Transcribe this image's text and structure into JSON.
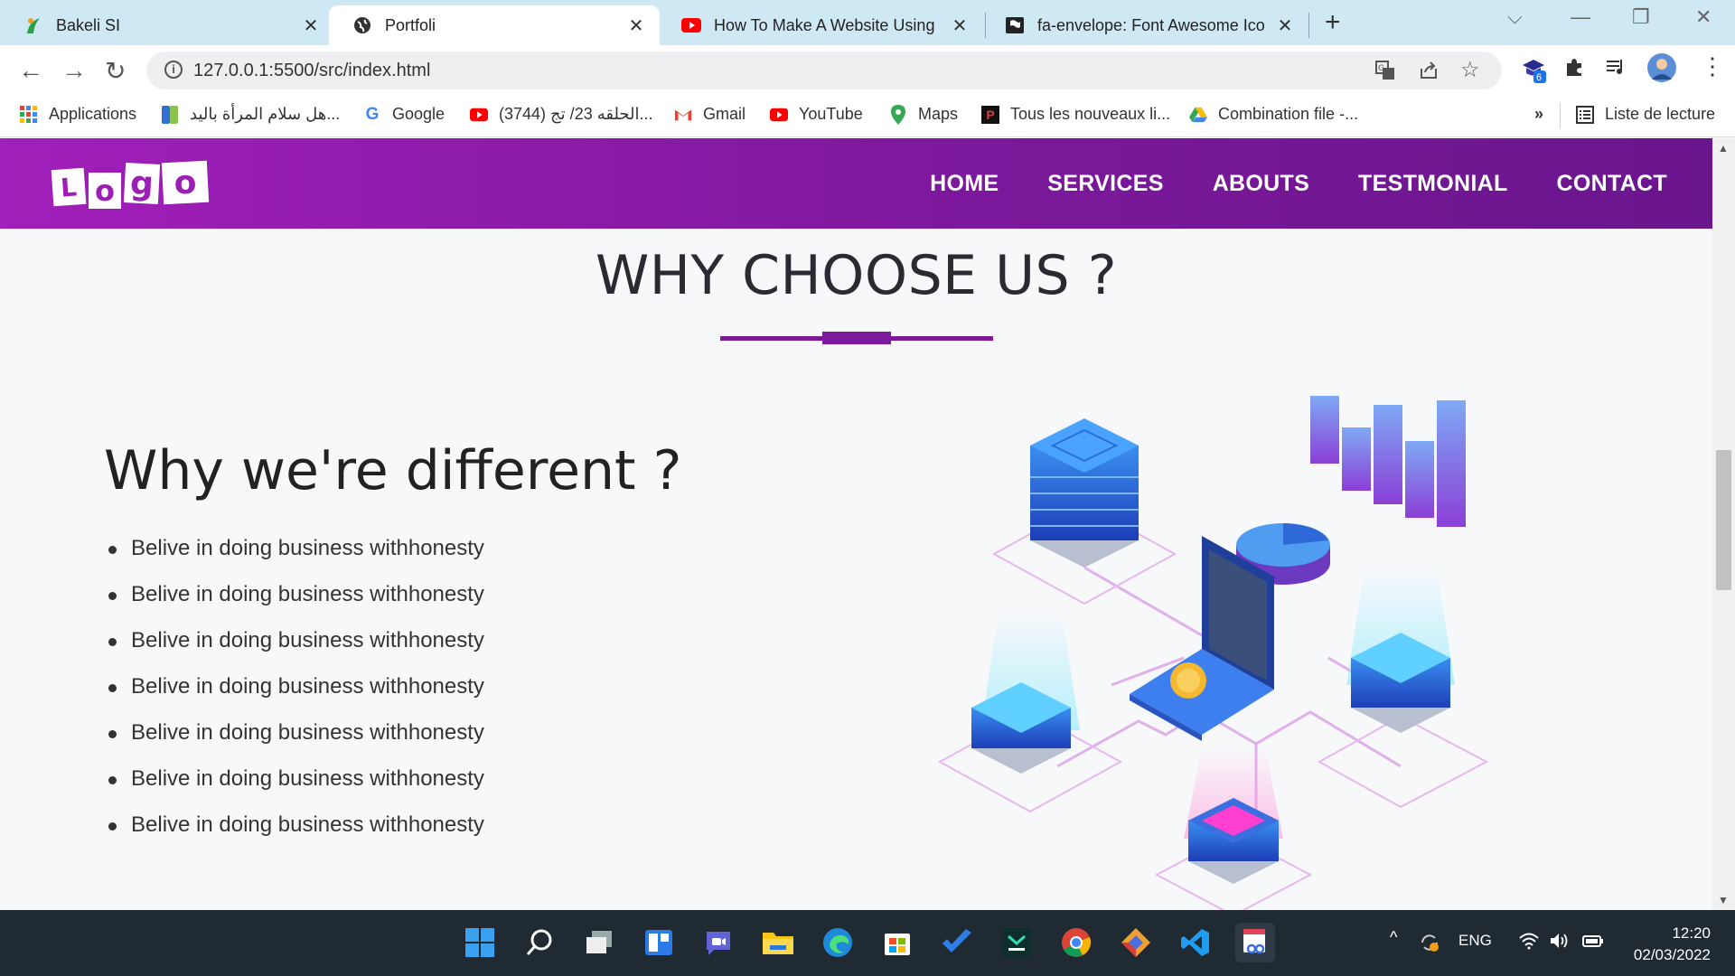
{
  "browser": {
    "tabs": [
      {
        "title": "Bakeli SI",
        "active": false
      },
      {
        "title": "Portfoli",
        "active": true
      },
      {
        "title": "How To Make A Website Using H",
        "active": false
      },
      {
        "title": "fa-envelope: Font Awesome Icon",
        "active": false
      }
    ],
    "url_host": "127.0.0.1",
    "url_rest": ":5500/src/index.html",
    "extension_badge": "6",
    "bookmarks": [
      {
        "label": "Applications",
        "icon": "apps-grid-icon"
      },
      {
        "label": "هل سلام المرأة باليد...",
        "icon": "bookmark-green-icon"
      },
      {
        "label": "Google",
        "icon": "google-icon"
      },
      {
        "label": "(3744) الحلقه 23/ تج...",
        "icon": "youtube-icon"
      },
      {
        "label": "Gmail",
        "icon": "gmail-icon"
      },
      {
        "label": "YouTube",
        "icon": "youtube-icon"
      },
      {
        "label": "Maps",
        "icon": "maps-icon"
      },
      {
        "label": "Tous les nouveaux li...",
        "icon": "p-icon"
      },
      {
        "label": "Combination file -...",
        "icon": "drive-icon"
      }
    ],
    "overflow": "»",
    "reading_list": "Liste de lecture"
  },
  "site": {
    "logo_letters": [
      "L",
      "o",
      "g",
      "o"
    ],
    "nav": [
      "HOME",
      "SERVICES",
      "ABOUTS",
      "TESTMONIAL",
      "CONTACT"
    ],
    "section_title": "WHY CHOOSE US ?",
    "subheading": "Why we're different ?",
    "features": [
      "Belive in doing business withhonesty",
      "Belive in doing business withhonesty",
      "Belive in doing business withhonesty",
      "Belive in doing business withhonesty",
      "Belive in doing business withhonesty",
      "Belive in doing business withhonesty",
      "Belive in doing business withhonesty"
    ],
    "colors": {
      "nav_start": "#a11fba",
      "nav_end": "#6a168d",
      "accent": "#7d1a9c"
    }
  },
  "taskbar": {
    "language": "ENG",
    "time": "12:20",
    "date": "02/03/2022",
    "apps": [
      "windows-start-icon",
      "search-icon",
      "task-view-icon",
      "widgets-icon",
      "teams-chat-icon",
      "file-explorer-icon",
      "edge-icon",
      "store-icon",
      "todo-icon",
      "app-icon",
      "chrome-icon",
      "git-icon",
      "vscode-icon",
      "snipping-tool-icon"
    ]
  }
}
